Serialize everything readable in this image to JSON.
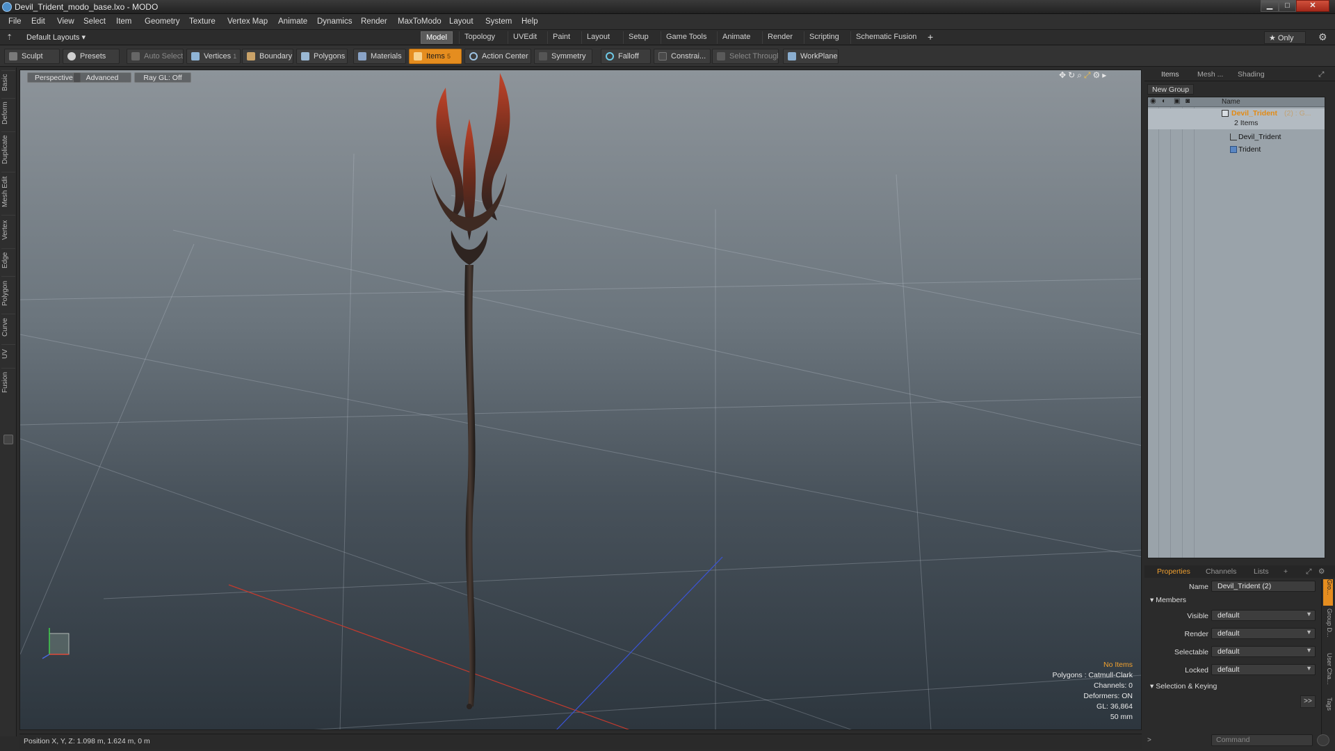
{
  "window": {
    "title": "Devil_Trident_modo_base.lxo - MODO",
    "min_label": "▁",
    "max_label": "□",
    "close_label": "✕"
  },
  "menu": [
    "File",
    "Edit",
    "View",
    "Select",
    "Item",
    "Geometry",
    "Texture",
    "Vertex Map",
    "Animate",
    "Dynamics",
    "Render",
    "MaxToModo",
    "Layout",
    "System",
    "Help"
  ],
  "layouts": {
    "selector": "Default Layouts ▾",
    "tabs": [
      "Model",
      "Topology",
      "UVEdit",
      "Paint",
      "Layout",
      "Setup",
      "Game Tools",
      "Animate",
      "Render",
      "Scripting",
      "Schematic Fusion"
    ],
    "active_tab": "Model",
    "add": "+",
    "only": "★  Only"
  },
  "toolbar": {
    "sculpt": "Sculpt",
    "presets": "Presets",
    "auto_select": "Auto Select",
    "vertices": "Vertices",
    "vertices_count": "1",
    "boundary": "Boundary",
    "polygons": "Polygons",
    "materials": "Materials",
    "items": "Items",
    "items_count": "5",
    "action_center": "Action Center",
    "symmetry": "Symmetry",
    "falloff": "Falloff",
    "constraints": "Constrai...",
    "select_through": "Select Through",
    "workplane": "WorkPlane"
  },
  "left_tabs": [
    "Basic",
    "Deform",
    "Duplicate",
    "Mesh Edit",
    "Vertex",
    "Edge",
    "Polygon",
    "Curve",
    "UV",
    "Fusion"
  ],
  "viewport": {
    "view": "Perspective",
    "shading": "Advanced",
    "raygl": "Ray GL: Off",
    "hud": {
      "selection": "No Items",
      "polygons": "Polygons : Catmull-Clark",
      "channels": "Channels: 0",
      "deformers": "Deformers: ON",
      "gl": "GL: 36,864",
      "unit": "50 mm"
    },
    "accent_color": "#e58d1f"
  },
  "status": {
    "position": "Position X, Y, Z:  1.098 m, 1.624 m, 0 m"
  },
  "items_panel": {
    "tabs": [
      "Items",
      "Mesh ...",
      "Shading"
    ],
    "new_group": "New Group",
    "name_header": "Name",
    "group_name": "Devil_Trident",
    "group_suffix": "(2) : G...",
    "group_count": "2 Items",
    "children": [
      "Devil_Trident",
      "Trident"
    ]
  },
  "properties": {
    "tabs": [
      "Properties",
      "Channels",
      "Lists",
      "+"
    ],
    "name_label": "Name",
    "name_value": "Devil_Trident (2)",
    "members": "Members",
    "fields": [
      {
        "label": "Visible",
        "value": "default"
      },
      {
        "label": "Render",
        "value": "default"
      },
      {
        "label": "Selectable",
        "value": "default"
      },
      {
        "label": "Locked",
        "value": "default"
      }
    ],
    "selection_keying": "Selection & Keying",
    "expand": ">>",
    "side_tabs": [
      "Gro...",
      "Group D...",
      "User Cha...",
      "Tags"
    ],
    "command_placeholder": "Command"
  }
}
